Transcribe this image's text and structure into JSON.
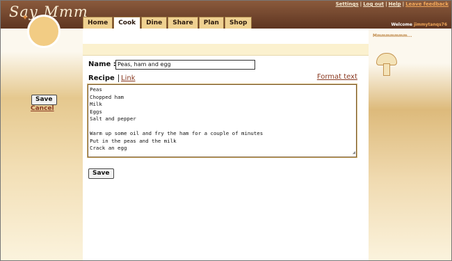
{
  "app": {
    "logo": "Say Mmm"
  },
  "toplinks": {
    "settings": "Settings",
    "logout": "Log out",
    "help": "Help",
    "feedback": "Leave feedback"
  },
  "welcome": {
    "label": "Welcome",
    "user": "jimmytanqs76"
  },
  "tabs": [
    "Home",
    "Cook",
    "Dine",
    "Share",
    "Plan",
    "Shop"
  ],
  "active_tab": "Cook",
  "left": {
    "save": "Save",
    "cancel": "Cancel"
  },
  "decor": {
    "right_text": "Mmmmmmmm..."
  },
  "form": {
    "name_label": "Name :",
    "name_value": "Peas, ham and egg",
    "recipe_tab": "Recipe",
    "link_tab": "Link",
    "format_text": "Format text",
    "recipe_text": "Peas\nChopped ham\nMilk\nEggs\nSalt and pepper\n\nWarm up some oil and fry the ham for a couple of minutes\nPut in the peas and the milk\nCrack an egg",
    "save": "Save"
  }
}
